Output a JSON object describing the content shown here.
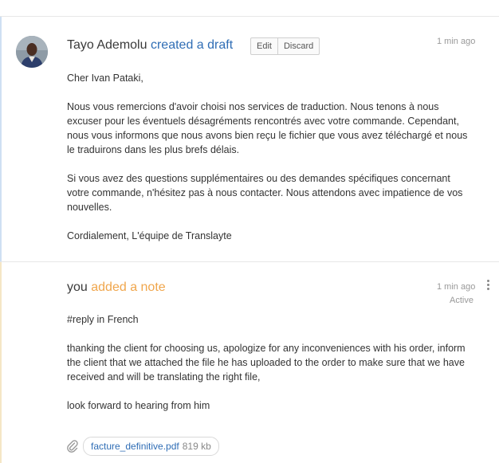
{
  "draft": {
    "author": "Tayo Ademolu",
    "action": "created a draft",
    "buttons": {
      "edit": "Edit",
      "discard": "Discard"
    },
    "time": "1 min ago",
    "body": [
      "Cher Ivan Pataki,",
      "Nous vous remercions d'avoir choisi nos services de traduction. Nous tenons à nous excuser pour les éventuels désagréments rencontrés avec votre commande. Cependant, nous vous informons que nous avons bien reçu le fichier que vous avez téléchargé et nous le traduirons dans les plus brefs délais.",
      "Si vous avez des questions supplémentaires ou des demandes spécifiques concernant votre commande, n'hésitez pas à nous contacter. Nous attendons avec impatience de vos nouvelles.",
      "Cordialement, L'équipe de Translayte"
    ]
  },
  "note": {
    "author": "you",
    "action": "added a note",
    "time": "1 min ago",
    "status": "Active",
    "body": [
      "#reply in French",
      "thanking the client for choosing us, apologize for any inconveniences with his order, inform the client that we attached the file he has uploaded to the order to make sure that we have received and will be translating the right file,",
      "look forward to hearing from him"
    ],
    "attachment": {
      "filename": "facture_definitive.pdf",
      "size": "819 kb"
    }
  },
  "colors": {
    "action_blue": "#2f6db5",
    "action_orange": "#f0a64c",
    "draft_bar": "#cfe0f3",
    "note_bar": "#f5e6c6"
  },
  "icons": [
    "avatar",
    "kebab-menu-icon",
    "paperclip-icon"
  ]
}
